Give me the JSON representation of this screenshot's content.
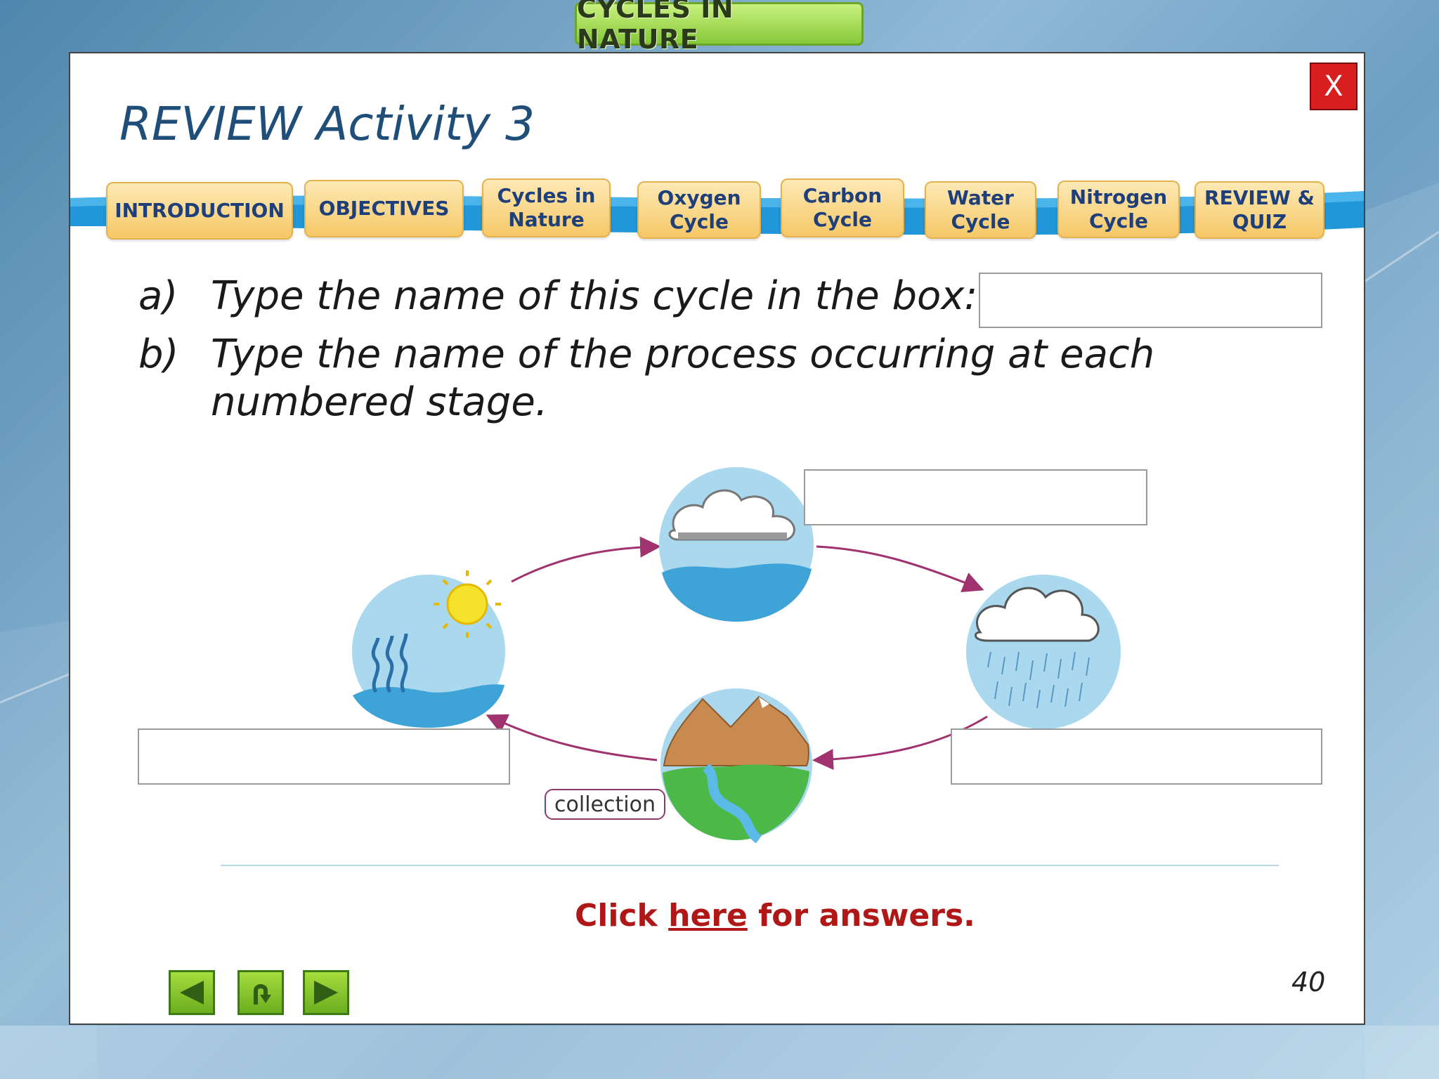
{
  "header": {
    "title": "CYCLES IN NATURE"
  },
  "slide": {
    "heading": "REVIEW Activity 3",
    "close_label": "X",
    "page_number": "40"
  },
  "nav": {
    "items": [
      {
        "label": "INTRODUCTION"
      },
      {
        "label": "OBJECTIVES"
      },
      {
        "label": "Cycles in\nNature"
      },
      {
        "label": "Oxygen\nCycle"
      },
      {
        "label": "Carbon\nCycle"
      },
      {
        "label": "Water\nCycle"
      },
      {
        "label": "Nitrogen\nCycle"
      },
      {
        "label": "REVIEW &\nQUIZ"
      }
    ]
  },
  "questions": {
    "a_letter": "a)",
    "a_text": "Type the name of this cycle in the box:",
    "b_letter": "b)",
    "b_text_line1": "Type the name of the process occurring at each",
    "b_text_line2": "numbered stage."
  },
  "diagram": {
    "collection_label": "collection"
  },
  "answers": {
    "prefix": "Click ",
    "link": "here",
    "suffix": " for answers."
  },
  "colors": {
    "accent_red": "#b01818",
    "nav_text": "#1f3f7a",
    "arrow_purple": "#a0326f"
  },
  "icons": [
    "back-arrow-icon",
    "return-icon",
    "forward-arrow-icon",
    "close-icon"
  ]
}
